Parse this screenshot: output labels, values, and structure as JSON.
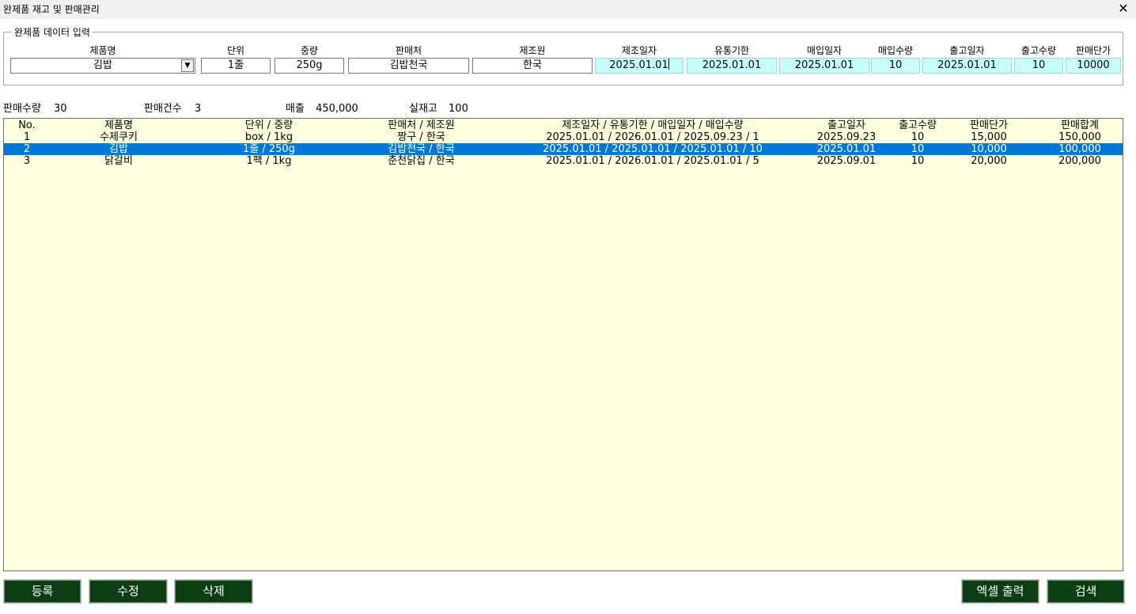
{
  "window": {
    "title": "완제품 재고 및 판매관리",
    "close_glyph": "✕"
  },
  "input_group": {
    "legend": "완제품 데이터 입력",
    "labels": {
      "product": "제품명",
      "unit": "단위",
      "weight": "중량",
      "seller": "판매처",
      "origin": "제조원",
      "mfg_date": "제조일자",
      "expiry": "유통기한",
      "purchase_date": "매입일자",
      "purchase_qty": "매입수량",
      "ship_date": "출고일자",
      "ship_qty": "출고수량",
      "unit_price": "판매단가"
    },
    "values": {
      "product": "김밥",
      "unit": "1줄",
      "weight": "250g",
      "seller": "김밥천국",
      "origin": "한국",
      "mfg_date": "2025.01.01",
      "expiry": "2025.01.01",
      "purchase_date": "2025.01.01",
      "purchase_qty": "10",
      "ship_date": "2025.01.01",
      "ship_qty": "10",
      "unit_price": "10000"
    }
  },
  "summary": {
    "sales_qty_label": "판매수량",
    "sales_qty": "30",
    "sales_count_label": "판매건수",
    "sales_count": "3",
    "revenue_label": "매출",
    "revenue": "450,000",
    "stock_label": "실재고",
    "stock": "100"
  },
  "table": {
    "headers": {
      "no": "No.",
      "name": "제품명",
      "unit_weight": "단위 / 중량",
      "seller_origin": "판매처 / 제조원",
      "dates": "제조일자   /   유통기한   /   매입일자   / 매입수량",
      "ship_date": "출고일자",
      "ship_qty": "출고수량",
      "unit_price": "판매단가",
      "total": "판매합계"
    },
    "rows": [
      {
        "no": "1",
        "name": "수제쿠키",
        "unit_weight": "box  /  1kg",
        "seller_origin": "짱구 / 한국",
        "dates": "2025.01.01 / 2026.01.01 / 2025.09.23  /  1",
        "ship_date": "2025.09.23",
        "ship_qty": "10",
        "unit_price": "15,000",
        "total": "150,000"
      },
      {
        "no": "2",
        "name": "김밥",
        "unit_weight": "1줄  /  250g",
        "seller_origin": "김밥천국 / 한국",
        "dates": "2025.01.01 / 2025.01.01 / 2025.01.01  /  10",
        "ship_date": "2025.01.01",
        "ship_qty": "10",
        "unit_price": "10,000",
        "total": "100,000"
      },
      {
        "no": "3",
        "name": "닭갈비",
        "unit_weight": "1팩  /  1kg",
        "seller_origin": "춘천닭집 / 한국",
        "dates": "2025.01.01 / 2026.01.01 / 2025.01.01  /  5",
        "ship_date": "2025.09.01",
        "ship_qty": "10",
        "unit_price": "20,000",
        "total": "200,000"
      }
    ]
  },
  "buttons": {
    "register": "등록",
    "edit": "수정",
    "delete": "삭제",
    "excel": "엑셀 출력",
    "search": "검색"
  },
  "colors": {
    "selected_row": "#0078d7",
    "list_bg": "#ffffe0",
    "button_bg": "#0a3d12",
    "date_field_bg": "#c8ffff"
  }
}
